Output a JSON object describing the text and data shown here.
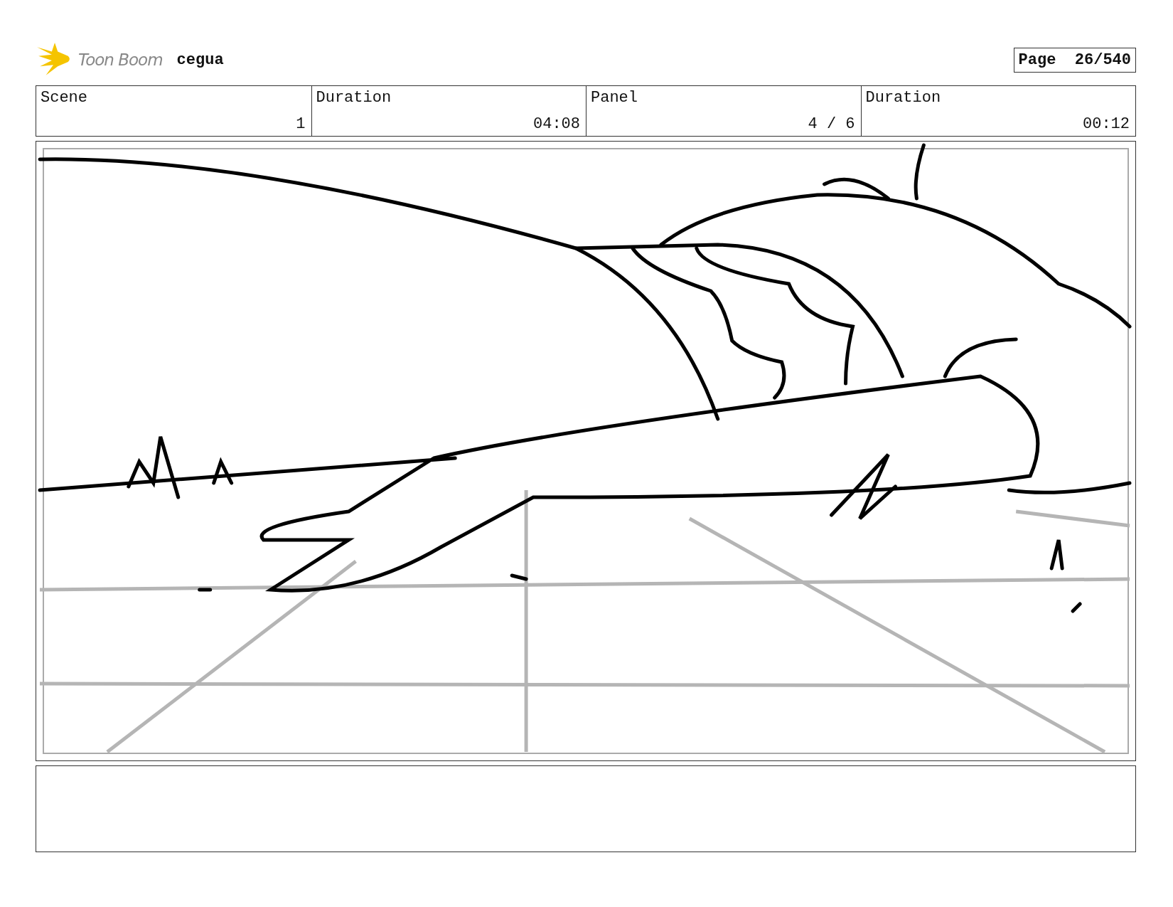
{
  "header": {
    "logo_text": "Toon Boom",
    "project": "cegua",
    "page": "Page  26/540"
  },
  "info": {
    "labels": [
      "Scene",
      "Duration",
      "Panel",
      "Duration"
    ],
    "values": [
      "1",
      "04:08",
      "4 / 6",
      "00:12"
    ]
  }
}
